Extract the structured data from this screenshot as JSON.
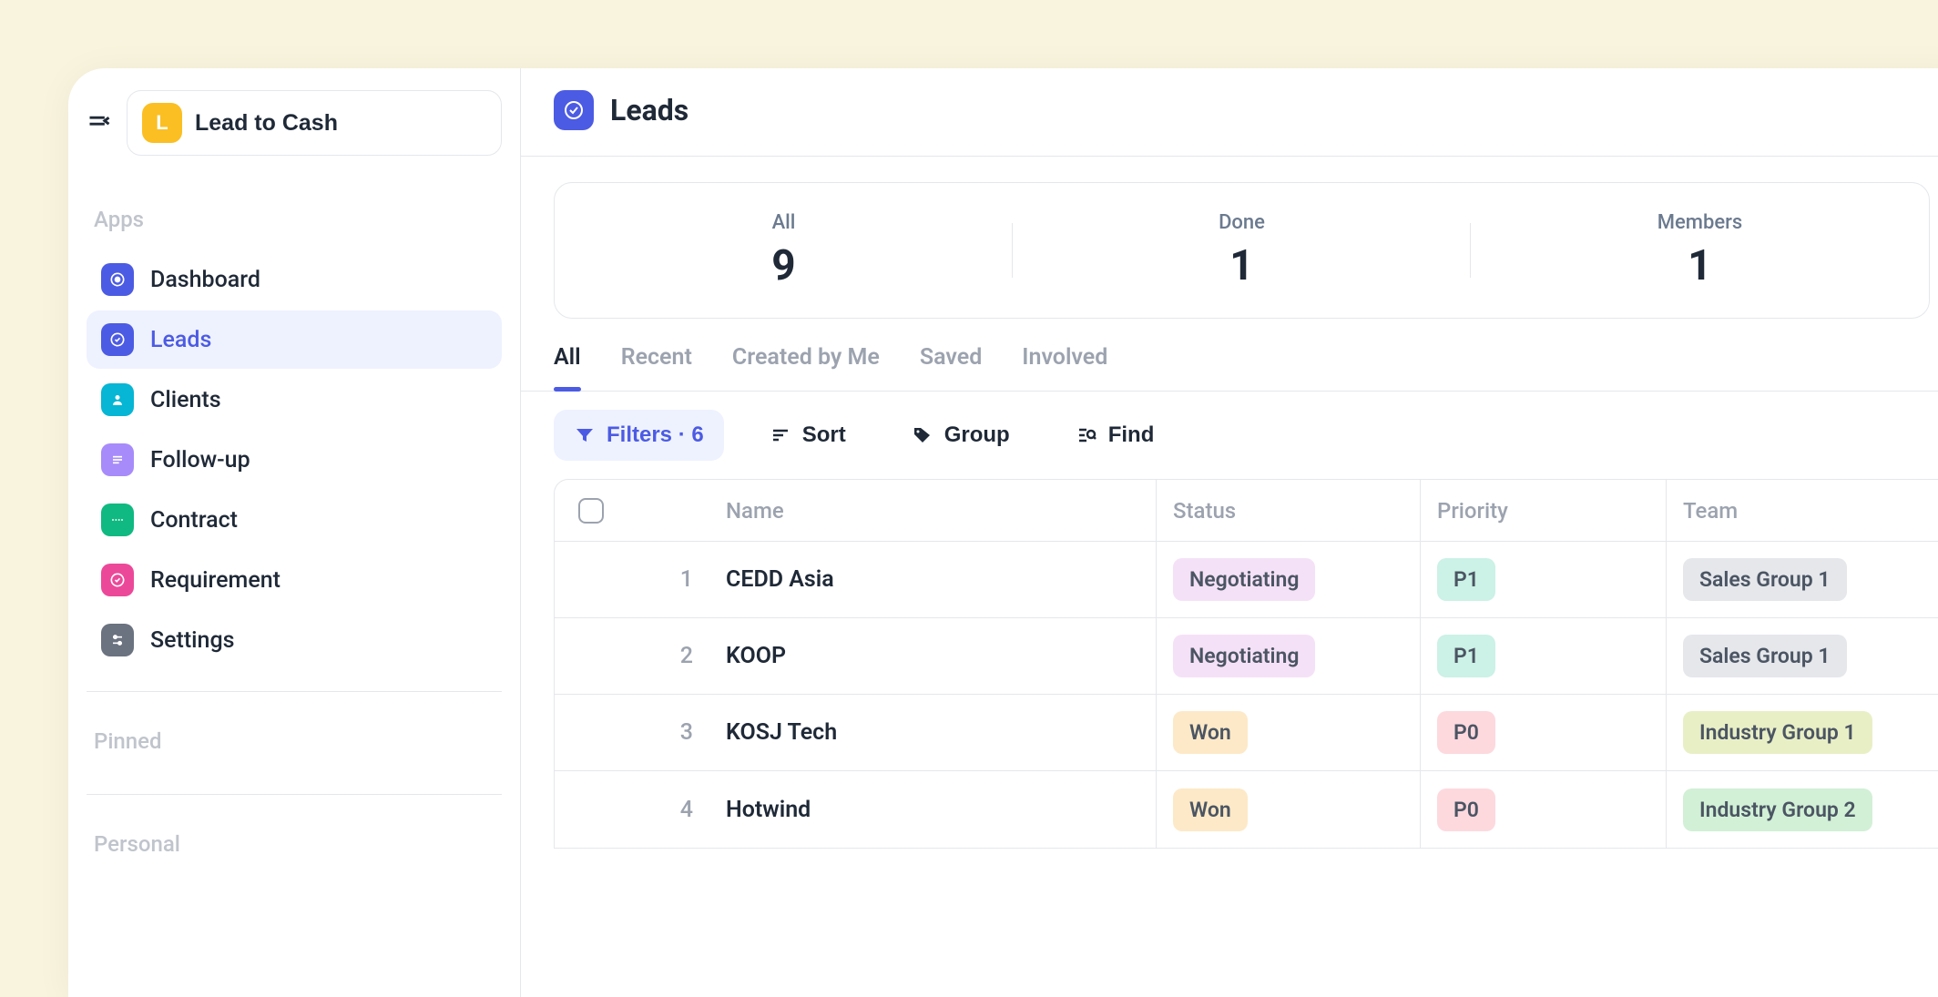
{
  "workspace": {
    "initial": "L",
    "name": "Lead to Cash"
  },
  "sidebar": {
    "apps_label": "Apps",
    "pinned_label": "Pinned",
    "personal_label": "Personal",
    "items": [
      {
        "label": "Dashboard"
      },
      {
        "label": "Leads"
      },
      {
        "label": "Clients"
      },
      {
        "label": "Follow-up"
      },
      {
        "label": "Contract"
      },
      {
        "label": "Requirement"
      },
      {
        "label": "Settings"
      }
    ]
  },
  "page": {
    "title": "Leads"
  },
  "stats": [
    {
      "label": "All",
      "value": "9"
    },
    {
      "label": "Done",
      "value": "1"
    },
    {
      "label": "Members",
      "value": "1"
    }
  ],
  "tabs": [
    {
      "label": "All"
    },
    {
      "label": "Recent"
    },
    {
      "label": "Created by Me"
    },
    {
      "label": "Saved"
    },
    {
      "label": "Involved"
    }
  ],
  "toolbar": {
    "filters_label": "Filters · 6",
    "sort_label": "Sort",
    "group_label": "Group",
    "find_label": "Find"
  },
  "table": {
    "columns": {
      "name": "Name",
      "status": "Status",
      "priority": "Priority",
      "team": "Team"
    },
    "rows": [
      {
        "idx": "1",
        "name": "CEDD Asia",
        "status": "Negotiating",
        "status_cls": "badge-negotiating",
        "priority": "P1",
        "priority_cls": "badge-p1",
        "team": "Sales Group 1",
        "team_cls": "badge-sales1"
      },
      {
        "idx": "2",
        "name": "KOOP",
        "status": "Negotiating",
        "status_cls": "badge-negotiating",
        "priority": "P1",
        "priority_cls": "badge-p1",
        "team": "Sales Group 1",
        "team_cls": "badge-sales1"
      },
      {
        "idx": "3",
        "name": "KOSJ Tech",
        "status": "Won",
        "status_cls": "badge-won",
        "priority": "P0",
        "priority_cls": "badge-p0",
        "team": "Industry Group 1",
        "team_cls": "badge-ind1"
      },
      {
        "idx": "4",
        "name": "Hotwind",
        "status": "Won",
        "status_cls": "badge-won",
        "priority": "P0",
        "priority_cls": "badge-p0",
        "team": "Industry Group 2",
        "team_cls": "badge-ind2"
      }
    ]
  }
}
